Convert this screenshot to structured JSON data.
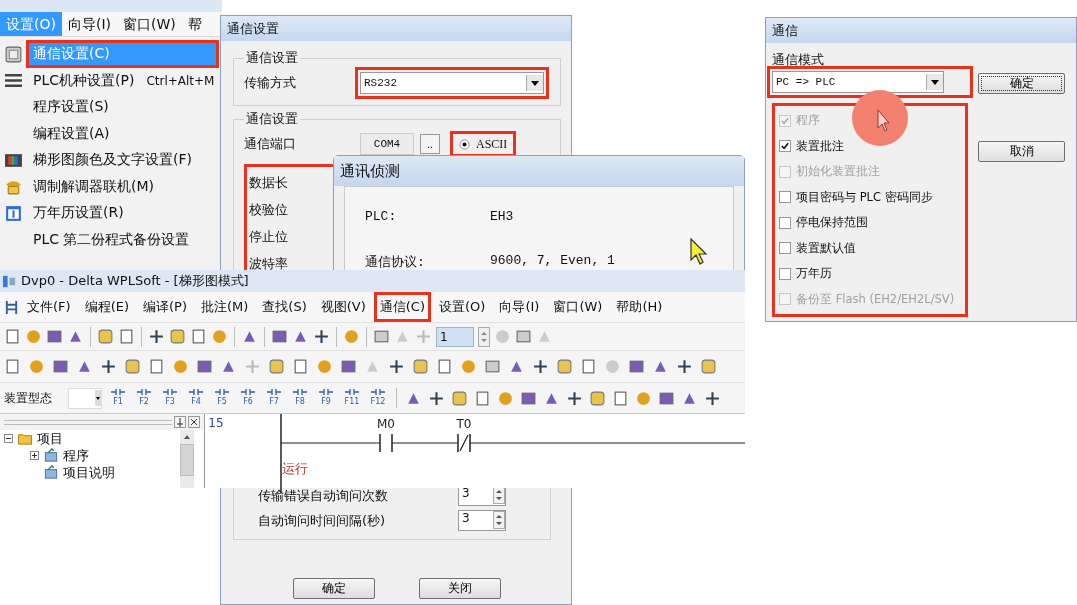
{
  "settings_menu": {
    "menu_bar": [
      {
        "label": "设置(O)",
        "selected": true
      },
      {
        "label": "向导(I)",
        "selected": false
      },
      {
        "label": "窗口(W)",
        "selected": false
      },
      {
        "label": "帮",
        "selected": false
      }
    ],
    "items": [
      {
        "label": "通信设置(C)",
        "selected": true,
        "highlighted": true
      },
      {
        "label": "PLC机种设置(P)",
        "shortcut": "Ctrl+Alt+M",
        "selected": false,
        "highlighted": false
      },
      {
        "label": "程序设置(S)",
        "selected": false,
        "highlighted": false
      },
      {
        "label": "编程设置(A)",
        "selected": false,
        "highlighted": false
      },
      {
        "label": "梯形图颜色及文字设置(F)",
        "selected": false,
        "highlighted": false
      },
      {
        "label": "调制解调器联机(M)",
        "selected": false,
        "highlighted": false
      },
      {
        "label": "万年历设置(R)",
        "selected": false,
        "highlighted": false
      },
      {
        "label": "PLC 第二份程式备份设置",
        "selected": false,
        "highlighted": false
      }
    ]
  },
  "comm_settings_dialog": {
    "title": "通信设置",
    "transfer_group": {
      "legend": "通信设置",
      "label": "传输方式",
      "value": "RS232",
      "highlighted": true
    },
    "port_group": {
      "legend": "通信设置",
      "port_label": "通信端口",
      "port": "COM4",
      "browse": "..",
      "mode": {
        "label": "ASCII",
        "selected": true,
        "highlighted": true
      },
      "fields": {
        "highlighted": true,
        "labels": [
          "数据长",
          "校验位",
          "停止位",
          "波特率"
        ]
      }
    },
    "retry": [
      {
        "label": "传输错误自动询问次数",
        "value": "3"
      },
      {
        "label": "自动询问时间间隔(秒)",
        "value": "3"
      }
    ],
    "buttons": [
      "确定",
      "关闭"
    ]
  },
  "detect_dialog": {
    "title": "通讯侦测",
    "rows": [
      {
        "label": "PLC:",
        "value": "EH3"
      },
      {
        "label": "通信协议:",
        "value": "9600, 7, Even, 1"
      }
    ]
  },
  "main_window": {
    "title": "Dvp0 - Delta WPLSoft - [梯形图模式]",
    "menu": [
      {
        "label": "文件(F)",
        "highlighted": false
      },
      {
        "label": "编程(E)",
        "highlighted": false
      },
      {
        "label": "编译(P)",
        "highlighted": false
      },
      {
        "label": "批注(M)",
        "highlighted": false
      },
      {
        "label": "查找(S)",
        "highlighted": false
      },
      {
        "label": "视图(V)",
        "highlighted": false
      },
      {
        "label": "通信(C)",
        "highlighted": true
      },
      {
        "label": "设置(O)",
        "highlighted": false
      },
      {
        "label": "向导(I)",
        "highlighted": false
      },
      {
        "label": "窗口(W)",
        "highlighted": false
      },
      {
        "label": "帮助(H)",
        "highlighted": false
      }
    ],
    "step_field": "1",
    "device_label": "装置型态",
    "function_keys": [
      "F1",
      "F2",
      "F3",
      "F4",
      "F5",
      "F6",
      "F7",
      "F8",
      "F9",
      "F11",
      "F12"
    ],
    "tree": [
      {
        "label": "项目",
        "expanded": true,
        "children": [
          {
            "label": "程序",
            "expanded": false
          },
          {
            "label": "项目说明"
          }
        ]
      }
    ],
    "ladder": {
      "line_number": "15",
      "contacts": [
        {
          "label": "M0",
          "kind": "no"
        },
        {
          "label": "T0",
          "kind": "nc"
        }
      ],
      "comment": "运行"
    }
  },
  "transfer_dialog": {
    "title": "通信",
    "mode_label": "通信模式",
    "mode": {
      "value": "PC => PLC",
      "highlighted": true
    },
    "options": {
      "highlighted": true,
      "items": [
        {
          "label": "程序",
          "checked": true,
          "disabled": true
        },
        {
          "label": "装置批注",
          "checked": true,
          "disabled": false
        },
        {
          "label": "初始化装置批注",
          "checked": false,
          "disabled": true
        },
        {
          "label": "项目密码与 PLC 密码同步",
          "checked": false,
          "disabled": false
        },
        {
          "label": "停电保持范围",
          "checked": false,
          "disabled": false
        },
        {
          "label": "装置默认值",
          "checked": false,
          "disabled": false
        },
        {
          "label": "万年历",
          "checked": false,
          "disabled": false
        },
        {
          "label": "备份至 Flash (EH2/EH2L/SV)",
          "checked": false,
          "disabled": true
        }
      ]
    },
    "buttons": [
      {
        "label": "确定",
        "default": true
      },
      {
        "label": "取消",
        "default": false
      }
    ]
  }
}
